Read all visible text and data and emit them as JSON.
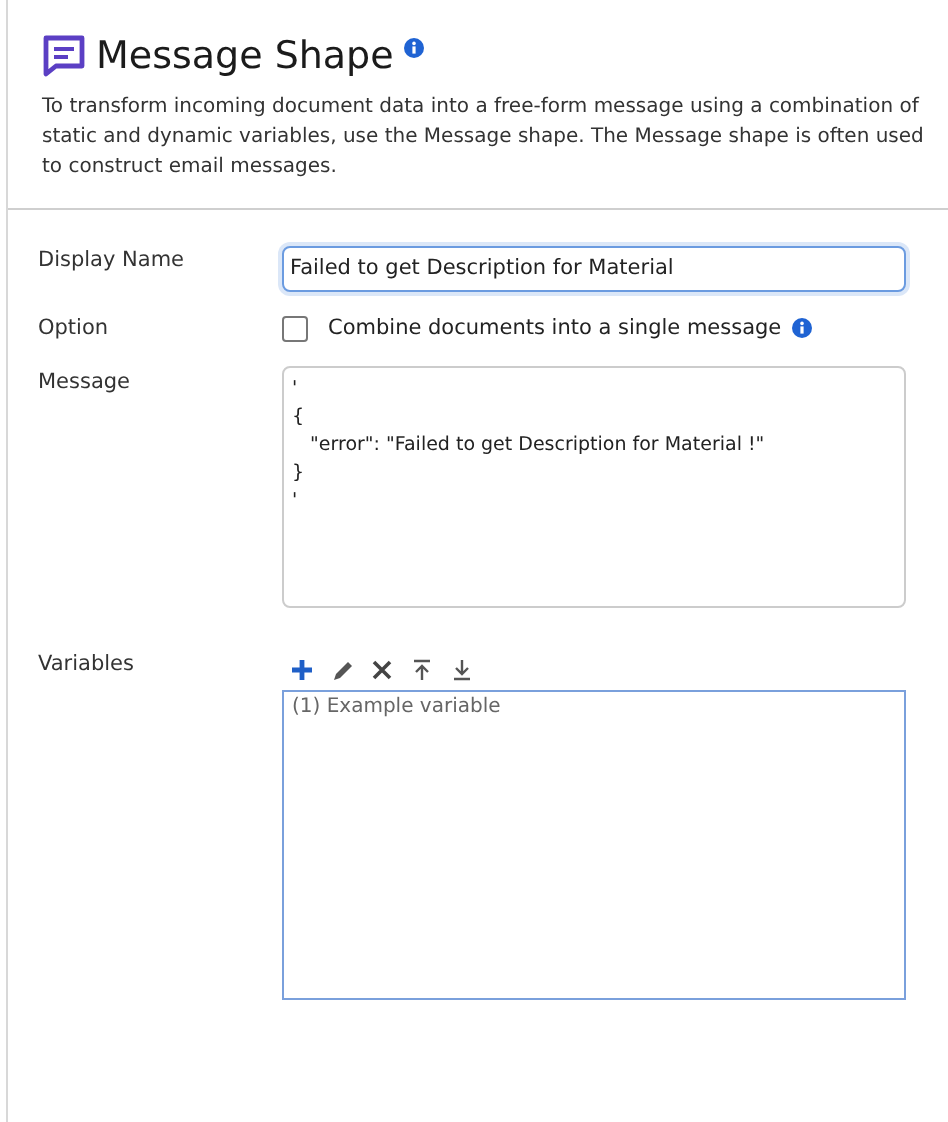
{
  "header": {
    "title": "Message Shape",
    "description": "To transform incoming document data into a free-form message using a combination of static and dynamic variables, use the Message shape. The Message shape is often used to construct email messages."
  },
  "fields": [
    {
      "kind": "text",
      "label": "Display Name",
      "value": "Failed to get Description for Material"
    },
    {
      "kind": "checkbox",
      "label": "Option",
      "option_label": "Combine documents into a single message",
      "checked": false
    },
    {
      "kind": "textarea",
      "label": "Message",
      "lines": [
        "'",
        "{",
        "   \"error\": \"Failed to get Description for Material !\"",
        "}",
        "'"
      ]
    },
    {
      "kind": "list",
      "label": "Variables",
      "toolbar": [
        {
          "kind": "add"
        },
        {
          "kind": "edit"
        },
        {
          "kind": "delete"
        },
        {
          "kind": "move-top"
        },
        {
          "kind": "move-bottom"
        }
      ],
      "items": [
        "(1) Example variable"
      ]
    }
  ]
}
